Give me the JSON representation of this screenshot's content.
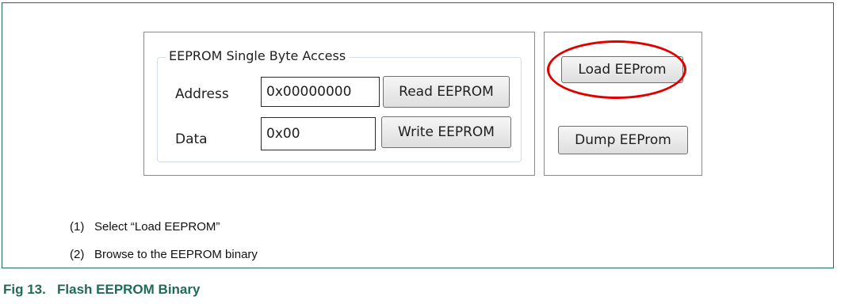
{
  "group": {
    "title": "EEPROM Single Byte Access"
  },
  "address": {
    "label": "Address",
    "value": "0x00000000",
    "button": "Read EEPROM"
  },
  "data_row": {
    "label": "Data",
    "value": "0x00",
    "button": "Write EEPROM"
  },
  "side": {
    "load_button": "Load EEProm",
    "dump_button": "Dump EEProm"
  },
  "steps": [
    {
      "num": "(1)",
      "text": "Select “Load EEPROM”"
    },
    {
      "num": "(2)",
      "text": "Browse to the EEPROM binary"
    }
  ],
  "caption": "Fig 13.   Flash EEPROM Binary",
  "colors": {
    "frame": "#1f6b57",
    "highlight": "#e00000",
    "caption": "#1f6b57"
  }
}
